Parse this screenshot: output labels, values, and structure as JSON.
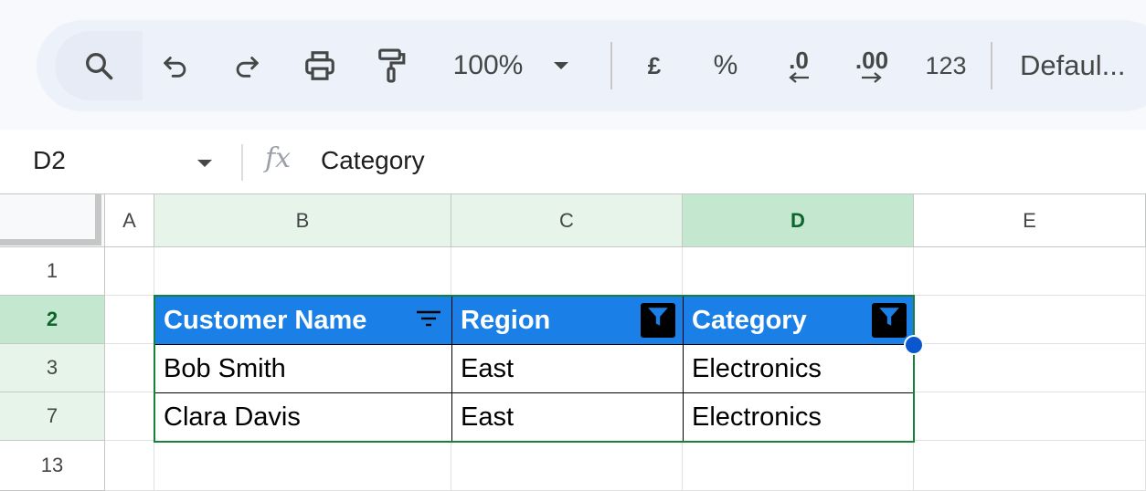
{
  "toolbar": {
    "zoom": "100%",
    "currency": "£",
    "percent": "%",
    "decrease_decimals": ".0",
    "increase_decimals": ".00",
    "number_format": "123",
    "font": "Defaul..."
  },
  "formula_bar": {
    "cell_ref": "D2",
    "fx": "fx",
    "value": "Category"
  },
  "columns": [
    "A",
    "B",
    "C",
    "D",
    "E"
  ],
  "rows": [
    "1",
    "2",
    "3",
    "7",
    "13"
  ],
  "table": {
    "headers": [
      "Customer Name",
      "Region",
      "Category"
    ],
    "data": [
      [
        "Bob Smith",
        "East",
        "Electronics"
      ],
      [
        "Clara Davis",
        "East",
        "Electronics"
      ]
    ]
  },
  "colors": {
    "header_fill": "#1a7fe6",
    "selected_header": "#c4e7cf",
    "selection_accent": "#0b57d0"
  }
}
